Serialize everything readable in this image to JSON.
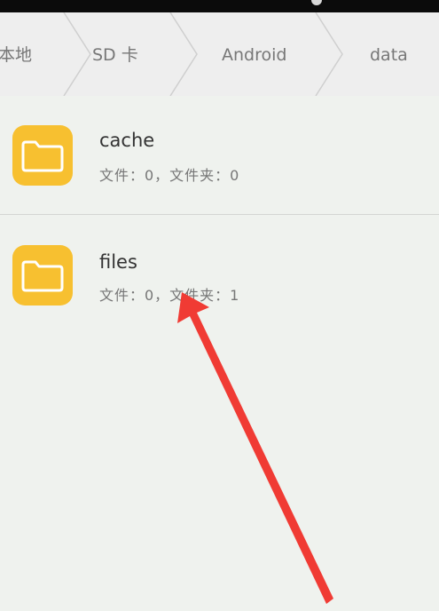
{
  "breadcrumb": {
    "items": [
      "本地",
      "SD 卡",
      "Android",
      "data"
    ]
  },
  "files": [
    {
      "name": "cache",
      "meta": "文件：0，文件夹：0",
      "icon": "folder-icon"
    },
    {
      "name": "files",
      "meta": "文件：0，文件夹：1",
      "icon": "folder-icon"
    }
  ],
  "colors": {
    "folder": "#f7c030",
    "annotation": "#f03b34",
    "background": "#eff2ee"
  }
}
